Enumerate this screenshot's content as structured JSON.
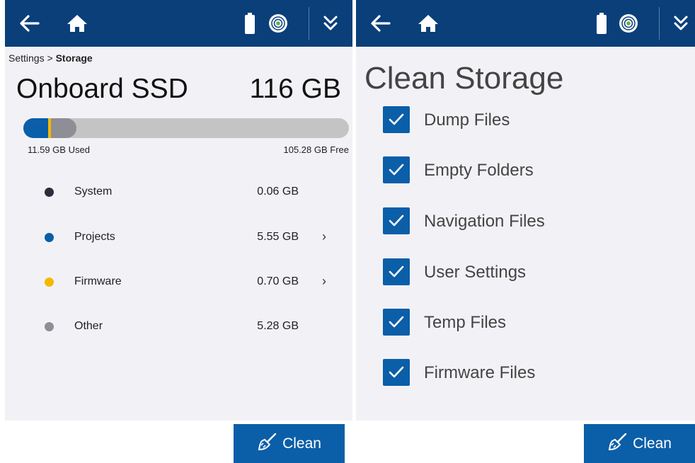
{
  "left": {
    "breadcrumb": {
      "parent": "Settings",
      "separator": ">",
      "current": "Storage"
    },
    "drive_name": "Onboard SSD",
    "drive_size": "116 GB",
    "usage_fraction": 0.1,
    "used_label": "11.59 GB Used",
    "free_label": "105.28 GB Free",
    "categories": [
      {
        "name": "System",
        "value": "0.06 GB",
        "color": "#2c2c3a",
        "chevron": ""
      },
      {
        "name": "Projects",
        "value": "5.55 GB",
        "color": "#0b5ea8",
        "chevron": "›"
      },
      {
        "name": "Firmware",
        "value": "0.70 GB",
        "color": "#f5b800",
        "chevron": "›"
      },
      {
        "name": "Other",
        "value": "5.28 GB",
        "color": "#8e8e96",
        "chevron": ""
      }
    ],
    "clean_label": "Clean"
  },
  "right": {
    "title": "Clean Storage",
    "items": [
      {
        "label": "Dump Files",
        "checked": true
      },
      {
        "label": "Empty Folders",
        "checked": true
      },
      {
        "label": "Navigation Files",
        "checked": true
      },
      {
        "label": "User Settings",
        "checked": true
      },
      {
        "label": "Temp Files",
        "checked": true
      },
      {
        "label": "Firmware Files",
        "checked": true
      }
    ],
    "clean_label": "Clean"
  },
  "colors": {
    "topbar": "#0a3f7a",
    "accent": "#0b5ea8",
    "background": "#f2f2f6"
  },
  "icons": [
    "back-arrow-icon",
    "home-icon",
    "battery-icon",
    "gps-signal-icon",
    "double-chevron-down-icon",
    "broom-icon"
  ]
}
